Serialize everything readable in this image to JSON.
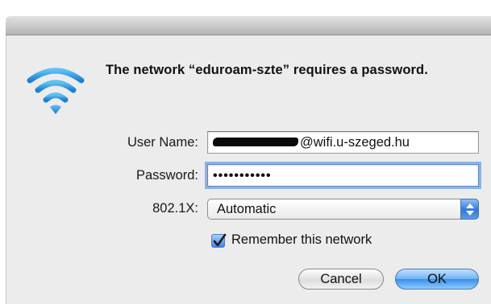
{
  "dialog": {
    "message": "The network “eduroam-szte” requires a password.",
    "icon": "wifi-icon"
  },
  "form": {
    "username_label": "User Name:",
    "username_value_suffix": "@wifi.u-szeged.hu",
    "password_label": "Password:",
    "password_value": "•••••••••••",
    "security_label": "802.1X:",
    "security_selected": "Automatic",
    "remember_label": "Remember this network",
    "remember_checked": true
  },
  "buttons": {
    "cancel_label": "Cancel",
    "ok_label": "OK"
  },
  "colors": {
    "wifi": "#2a8fd6",
    "accent": "#3b86e3"
  }
}
